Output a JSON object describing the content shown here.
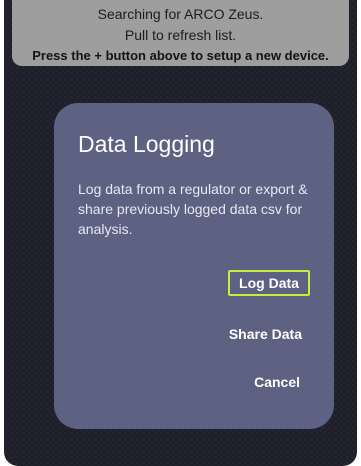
{
  "banner": {
    "line1": "Searching for ARCO Zeus.",
    "line2": "Pull to refresh list.",
    "line3": "Press the + button above to setup a new device."
  },
  "dialog": {
    "title": "Data Logging",
    "message": "Log data from a regulator or export & share previously logged data csv for analysis.",
    "buttons": {
      "log": "Log Data",
      "share": "Share Data",
      "cancel": "Cancel"
    }
  },
  "colors": {
    "background": "#1f1f2c",
    "banner": "#9e9e9e",
    "dialog": "#5d6182",
    "focus_outline": "#c6ef3a"
  }
}
